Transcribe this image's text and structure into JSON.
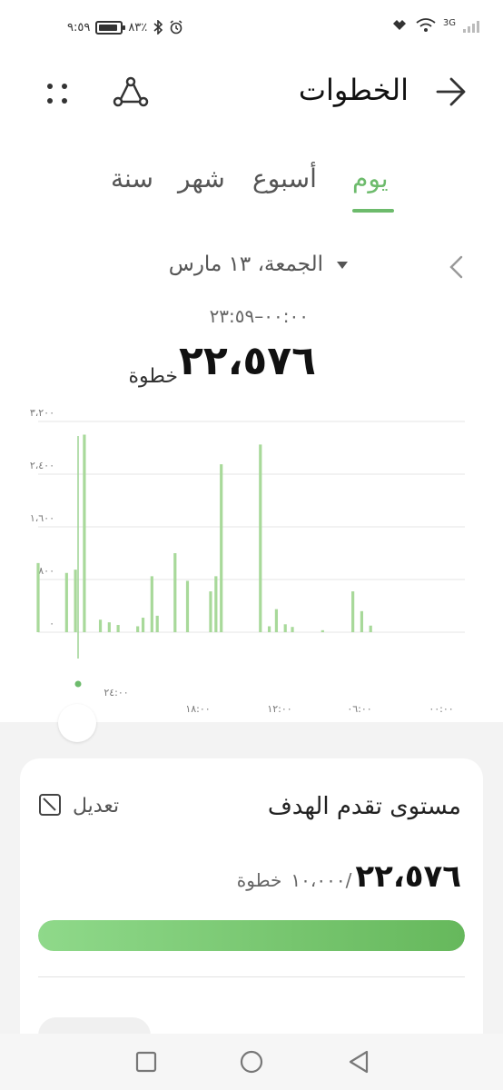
{
  "status_bar": {
    "time": "٩:٥٩",
    "battery": "٨٣٪",
    "network": "3G"
  },
  "header": {
    "title": "الخطوات"
  },
  "tabs": [
    {
      "label": "يوم",
      "active": true
    },
    {
      "label": "أسبوع",
      "active": false
    },
    {
      "label": "شهر",
      "active": false
    },
    {
      "label": "سنة",
      "active": false
    }
  ],
  "date": {
    "label": "الجمعة، ١٣ مارس",
    "time_range": "٠٠:٠٠–٢٣:٥٩"
  },
  "summary": {
    "total": "٢٢،٥٧٦",
    "unit": "خطوة"
  },
  "chart_data": {
    "type": "bar",
    "yticks": [
      "٣،٢٠٠",
      "٢،٤٠٠",
      "١،٦٠٠",
      "٨٠٠",
      "٠"
    ],
    "ylim": [
      0,
      3200
    ],
    "xticks": [
      "٢٤:٠٠",
      "١٨:٠٠",
      "١٢:٠٠",
      "٠٦:٠٠",
      "٠٠:٠٠"
    ],
    "xlim": [
      0,
      24
    ],
    "grid": true,
    "color": "#a8d99a",
    "x": [
      5.3,
      5.8,
      6.3,
      8.0,
      9.7,
      10.1,
      10.6,
      11.0,
      11.5,
      13.7,
      14.0,
      14.3,
      15.6,
      16.3,
      17.3,
      17.6,
      18.1,
      18.4,
      19.5,
      20.0,
      20.5,
      21.4,
      21.9,
      22.4,
      24.0
    ],
    "values": [
      100,
      320,
      620,
      30,
      80,
      120,
      350,
      90,
      2850,
      2550,
      850,
      620,
      780,
      1200,
      250,
      850,
      220,
      90,
      110,
      150,
      190,
      3000,
      950,
      900,
      1050
    ]
  },
  "goal_card": {
    "title": "مستوى تقدم الهدف",
    "edit_label": "تعديل",
    "current": "٢٢،٥٧٦",
    "goal": "/١٠،٠٠٠",
    "unit": "خطوة",
    "progress_fraction": 1.0
  }
}
